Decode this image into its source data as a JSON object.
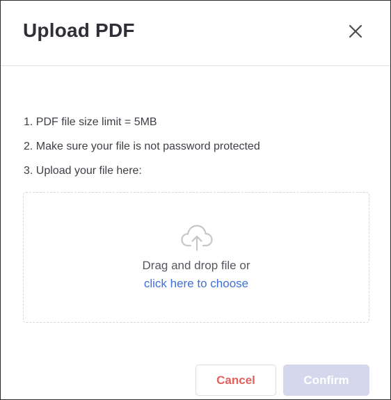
{
  "dialog": {
    "title": "Upload PDF",
    "close_icon": "close-icon"
  },
  "instructions": [
    "1. PDF file size limit = 5MB",
    "2. Make sure your file is not password protected",
    "3. Upload your file here:"
  ],
  "dropzone": {
    "icon": "cloud-upload-icon",
    "drag_text": "Drag and drop file or",
    "choose_link": "click here to choose"
  },
  "buttons": {
    "cancel_label": "Cancel",
    "confirm_label": "Confirm",
    "confirm_disabled": true
  },
  "colors": {
    "title": "#2f3037",
    "link": "#3f6fdc",
    "cancel_text": "#e2605d",
    "confirm_bg_disabled": "#d5d8ec",
    "icon": "#c4c6cb"
  }
}
